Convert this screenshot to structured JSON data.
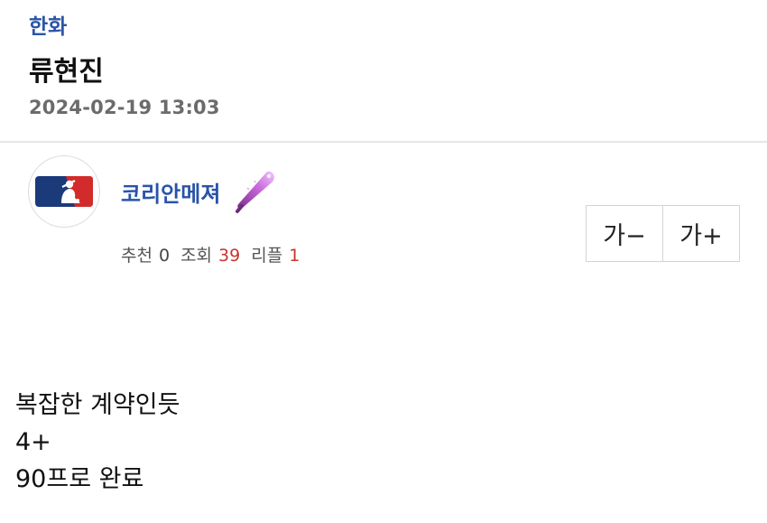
{
  "post": {
    "category": "한화",
    "title": "류현진",
    "datetime": "2024-02-19 13:03"
  },
  "author": {
    "name": "코리안메져",
    "avatar_icon": "mlb-logo-icon",
    "badge_icon": "purple-bat-icon"
  },
  "stats": {
    "recommend_label": "추천",
    "recommend_value": "0",
    "views_label": "조회",
    "views_value": "39",
    "replies_label": "리플",
    "replies_value": "1"
  },
  "font_controls": {
    "decrease_label": "가−",
    "increase_label": "가+"
  },
  "content": {
    "lines": [
      "복잡한 계약인듯",
      "4+",
      "90프로 완료"
    ]
  },
  "colors": {
    "accent_blue": "#2a54a8",
    "count_red": "#c8352e",
    "meta_gray": "#6b6b6b"
  }
}
